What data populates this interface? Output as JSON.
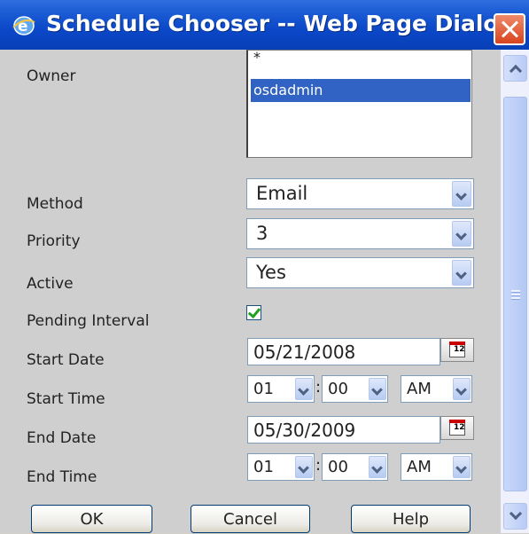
{
  "window": {
    "title": "Schedule Chooser -- Web Page Dialog",
    "icon": "ie-icon"
  },
  "form": {
    "owner": {
      "label": "Owner",
      "options": [
        "*",
        "osdadmin"
      ],
      "selected": "osdadmin"
    },
    "method": {
      "label": "Method",
      "value": "Email"
    },
    "priority": {
      "label": "Priority",
      "value": "3"
    },
    "active": {
      "label": "Active",
      "value": "Yes"
    },
    "pending_interval": {
      "label": "Pending Interval",
      "checked": true
    },
    "start_date": {
      "label": "Start Date",
      "value": "05/21/2008"
    },
    "start_time": {
      "label": "Start Time",
      "hour": "01",
      "minute": "00",
      "ampm": "AM"
    },
    "end_date": {
      "label": "End Date",
      "value": "05/30/2009"
    },
    "end_time": {
      "label": "End Time",
      "hour": "01",
      "minute": "00",
      "ampm": "AM"
    },
    "time_separator": ":"
  },
  "calendar_icon_text": "12",
  "buttons": {
    "ok": "OK",
    "cancel": "Cancel",
    "help": "Help"
  }
}
